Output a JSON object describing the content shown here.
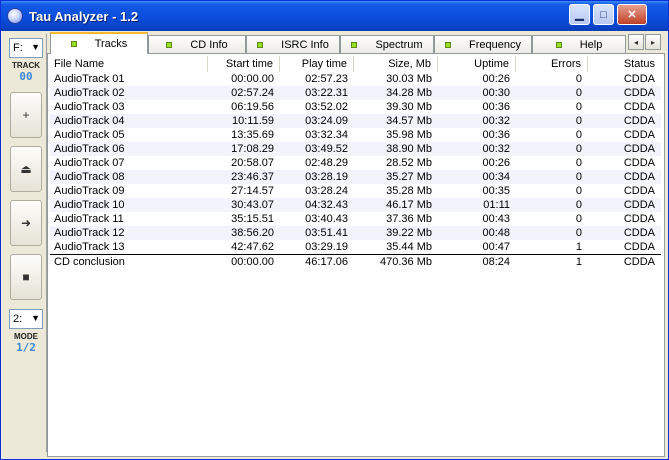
{
  "window": {
    "title": "Tau Analyzer - 1.2",
    "min_label": "▁",
    "max_label": "□",
    "close_label": "✕"
  },
  "sidebar": {
    "drive": "F:",
    "track_label": "TRACK",
    "track_value": "00",
    "speed": "2:",
    "mode_label": "MODE",
    "mode_value": "1/2",
    "buttons": [
      {
        "name": "add",
        "glyph": "+"
      },
      {
        "name": "eject",
        "glyph": "⏏"
      },
      {
        "name": "play",
        "glyph": "➜"
      },
      {
        "name": "stop",
        "glyph": "■"
      }
    ]
  },
  "tabs": [
    "Tracks",
    "CD Info",
    "ISRC Info",
    "Spectrum",
    "Frequency",
    "Help"
  ],
  "tab_scroll": {
    "left": "◂",
    "right": "▸"
  },
  "columns": [
    "File Name",
    "Start time",
    "Play time",
    "Size, Mb",
    "Uptime",
    "Errors",
    "Status"
  ],
  "rows": [
    [
      "AudioTrack 01",
      "00:00.00",
      "02:57.23",
      "30.03 Mb",
      "00:26",
      "0",
      "CDDA"
    ],
    [
      "AudioTrack 02",
      "02:57.24",
      "03:22.31",
      "34.28 Mb",
      "00:30",
      "0",
      "CDDA"
    ],
    [
      "AudioTrack 03",
      "06:19.56",
      "03:52.02",
      "39.30 Mb",
      "00:36",
      "0",
      "CDDA"
    ],
    [
      "AudioTrack 04",
      "10:11.59",
      "03:24.09",
      "34.57 Mb",
      "00:32",
      "0",
      "CDDA"
    ],
    [
      "AudioTrack 05",
      "13:35.69",
      "03:32.34",
      "35.98 Mb",
      "00:36",
      "0",
      "CDDA"
    ],
    [
      "AudioTrack 06",
      "17:08.29",
      "03:49.52",
      "38.90 Mb",
      "00:32",
      "0",
      "CDDA"
    ],
    [
      "AudioTrack 07",
      "20:58.07",
      "02:48.29",
      "28.52 Mb",
      "00:26",
      "0",
      "CDDA"
    ],
    [
      "AudioTrack 08",
      "23:46.37",
      "03:28.19",
      "35.27 Mb",
      "00:34",
      "0",
      "CDDA"
    ],
    [
      "AudioTrack 09",
      "27:14.57",
      "03:28.24",
      "35.28 Mb",
      "00:35",
      "0",
      "CDDA"
    ],
    [
      "AudioTrack 10",
      "30:43.07",
      "04:32.43",
      "46.17 Mb",
      "01:11",
      "0",
      "CDDA"
    ],
    [
      "AudioTrack 11",
      "35:15.51",
      "03:40.43",
      "37.36 Mb",
      "00:43",
      "0",
      "CDDA"
    ],
    [
      "AudioTrack 12",
      "38:56.20",
      "03:51.41",
      "39.22 Mb",
      "00:48",
      "0",
      "CDDA"
    ],
    [
      "AudioTrack 13",
      "42:47.62",
      "03:29.19",
      "35.44 Mb",
      "00:47",
      "1",
      "CDDA"
    ]
  ],
  "summary": [
    "CD conclusion",
    "00:00.00",
    "46:17.06",
    "470.36 Mb",
    "08:24",
    "1",
    "CDDA"
  ]
}
